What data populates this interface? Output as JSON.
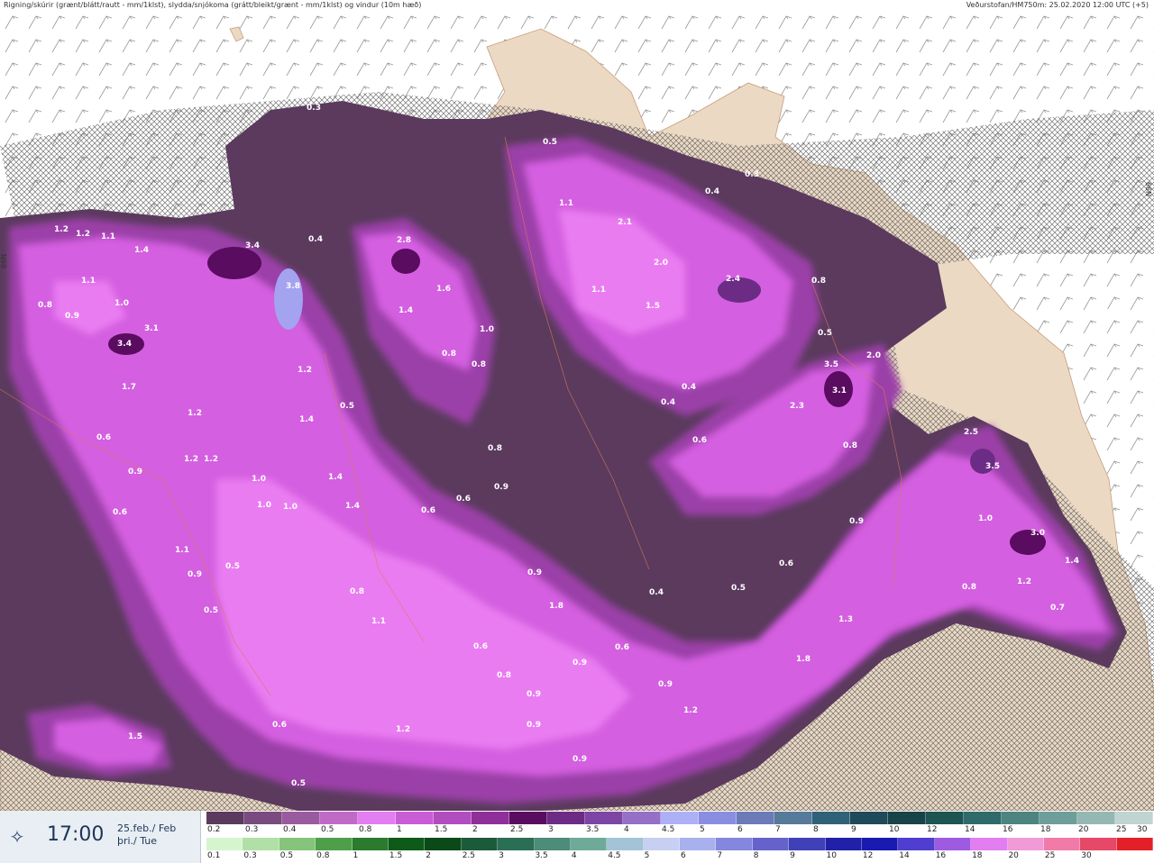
{
  "header": {
    "title": "Rigning/skúrir (grænt/blátt/rautt - mm/1klst), slydda/snjókoma (grátt/bleikt/grænt - mm/1klst) og vindur (10m hæð)",
    "source": "Veðurstofan/HM750m: 25.02.2020 12:00 UTC (+5)"
  },
  "map": {
    "lat_label": "66N",
    "colors": {
      "land": "#ecd9c4",
      "sea": "#ffffff",
      "hatch": "#555555",
      "precip_dark": "#5b3a5e",
      "precip_mid": "#9b3fa8",
      "precip_bright": "#d45ee0",
      "precip_light": "#ee82f4",
      "precip_peak": "#a3a3f0"
    },
    "value_labels": [
      "0.3",
      "0.5",
      "0.3",
      "0.4",
      "1.2",
      "1.2",
      "1.1",
      "1.4",
      "3.4",
      "2.8",
      "2.1",
      "1.1",
      "0.4",
      "1.1",
      "0.8",
      "0.9",
      "1.0",
      "3.8",
      "1.6",
      "2.0",
      "2.4",
      "1.1",
      "1.5",
      "0.8",
      "3.4",
      "3.1",
      "1.4",
      "0.5",
      "0.5",
      "1.0",
      "1.7",
      "1.2",
      "0.8",
      "0.8",
      "3.5",
      "2.0",
      "0.4",
      "3.1",
      "2.3",
      "0.4",
      "1.2",
      "1.4",
      "0.5",
      "0.6",
      "0.8",
      "0.6",
      "1.2",
      "1.2",
      "0.9",
      "1.0",
      "1.4",
      "0.6",
      "0.8",
      "2.5",
      "3.5",
      "1.0",
      "1.0",
      "1.4",
      "0.6",
      "0.9",
      "0.6",
      "1.1",
      "1.0",
      "0.9",
      "3.0",
      "1.4",
      "0.5",
      "0.9",
      "0.5",
      "0.9",
      "0.6",
      "0.5",
      "0.8",
      "0.4",
      "0.8",
      "1.2",
      "1.1",
      "1.3",
      "1.8",
      "0.6",
      "0.7",
      "1.8",
      "0.6",
      "0.9",
      "0.8",
      "0.9",
      "0.9",
      "1.2",
      "1.5",
      "0.6",
      "0.9",
      "1.2",
      "0.9",
      "0.5"
    ]
  },
  "footer": {
    "time": "17:00",
    "date_line1": "25.feb./ Feb",
    "date_line2": "þri./ Tue",
    "logo_icon": "vedur-logo-icon",
    "scale_top": {
      "colors": [
        "#5b3a5e",
        "#7a4b7e",
        "#9a5aa0",
        "#c06ac8",
        "#e27ef0",
        "#c95dd6",
        "#b24dbf",
        "#8f2f9a",
        "#5a0c60",
        "#6c2c86",
        "#7d45a4",
        "#9470c6",
        "#aeb0f6",
        "#8a8ee0",
        "#6c7ab8",
        "#557a9a",
        "#2f6178",
        "#1f4a5a",
        "#174349",
        "#1c5552",
        "#2f6b6a",
        "#4c8480",
        "#6e9e99",
        "#95b8b4",
        "#c0d4d2"
      ],
      "labels": [
        "0.2",
        "0.3",
        "0.4",
        "0.5",
        "0.8",
        "1",
        "1.5",
        "2",
        "2.5",
        "3",
        "3.5",
        "4",
        "4.5",
        "5",
        "6",
        "7",
        "8",
        "9",
        "10",
        "12",
        "14",
        "16",
        "18",
        "20",
        "25",
        "30"
      ]
    },
    "scale_bottom": {
      "colors": [
        "#d5f5cf",
        "#b1e0a6",
        "#85c47a",
        "#4f9f4a",
        "#2b7a2e",
        "#0e5a18",
        "#0b4a18",
        "#1c5b3a",
        "#2a6e55",
        "#4c8c78",
        "#6faa99",
        "#a3c3d6",
        "#c7cff2",
        "#a9b0ee",
        "#8586de",
        "#6562cc",
        "#4040b8",
        "#2020a8",
        "#1a1ab0",
        "#4f3ed0",
        "#9f5ae2",
        "#e27ef0",
        "#f19ad8",
        "#f27aa8",
        "#e64868",
        "#e3202a"
      ],
      "labels": [
        "0.1",
        "0.3",
        "0.5",
        "0.8",
        "1",
        "1.5",
        "2",
        "2.5",
        "3",
        "3.5",
        "4",
        "4.5",
        "5",
        "6",
        "7",
        "8",
        "9",
        "10",
        "12",
        "14",
        "16",
        "18",
        "20",
        "25",
        "30"
      ]
    }
  }
}
